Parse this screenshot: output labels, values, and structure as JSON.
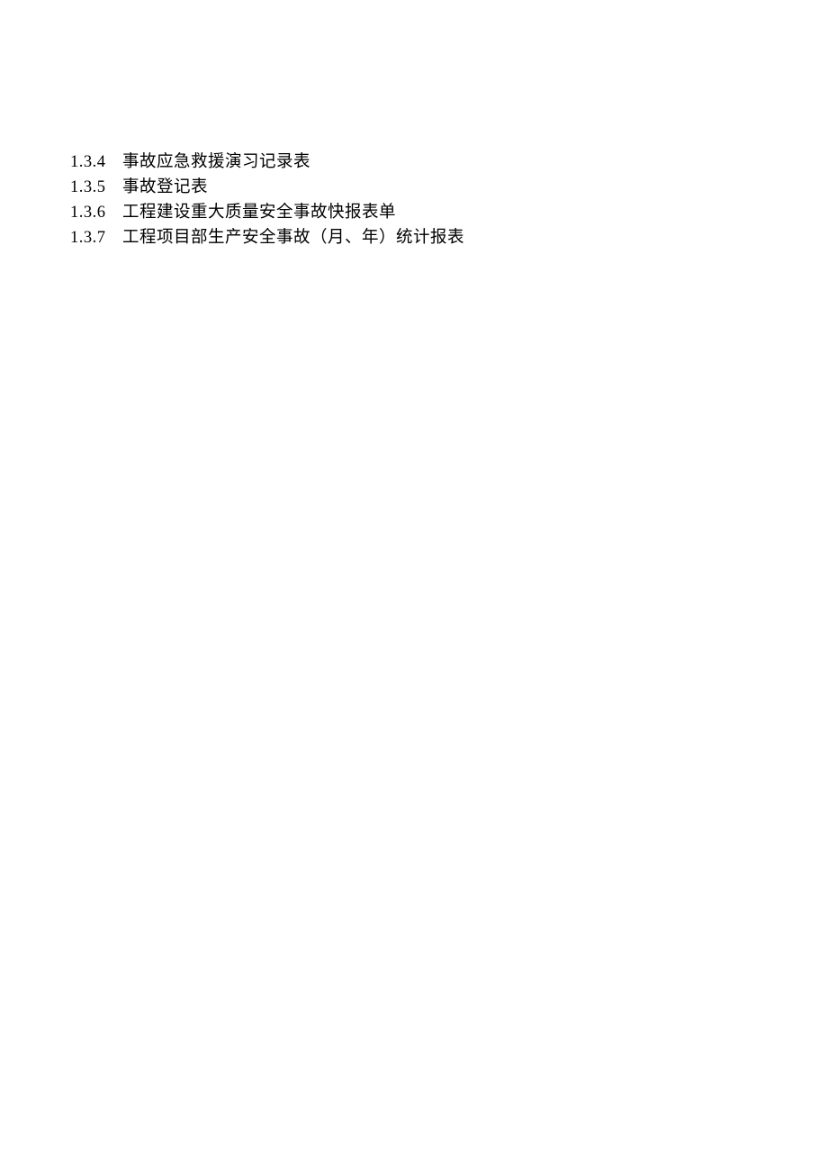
{
  "items": [
    {
      "num": "1.3.4",
      "text": "事故应急救援演习记录表"
    },
    {
      "num": "1.3.5",
      "text": "事故登记表"
    },
    {
      "num": "1.3.6",
      "text": "工程建设重大质量安全事故快报表单"
    },
    {
      "num": "1.3.7",
      "text": "工程项目部生产安全事故（月、年）统计报表"
    }
  ]
}
